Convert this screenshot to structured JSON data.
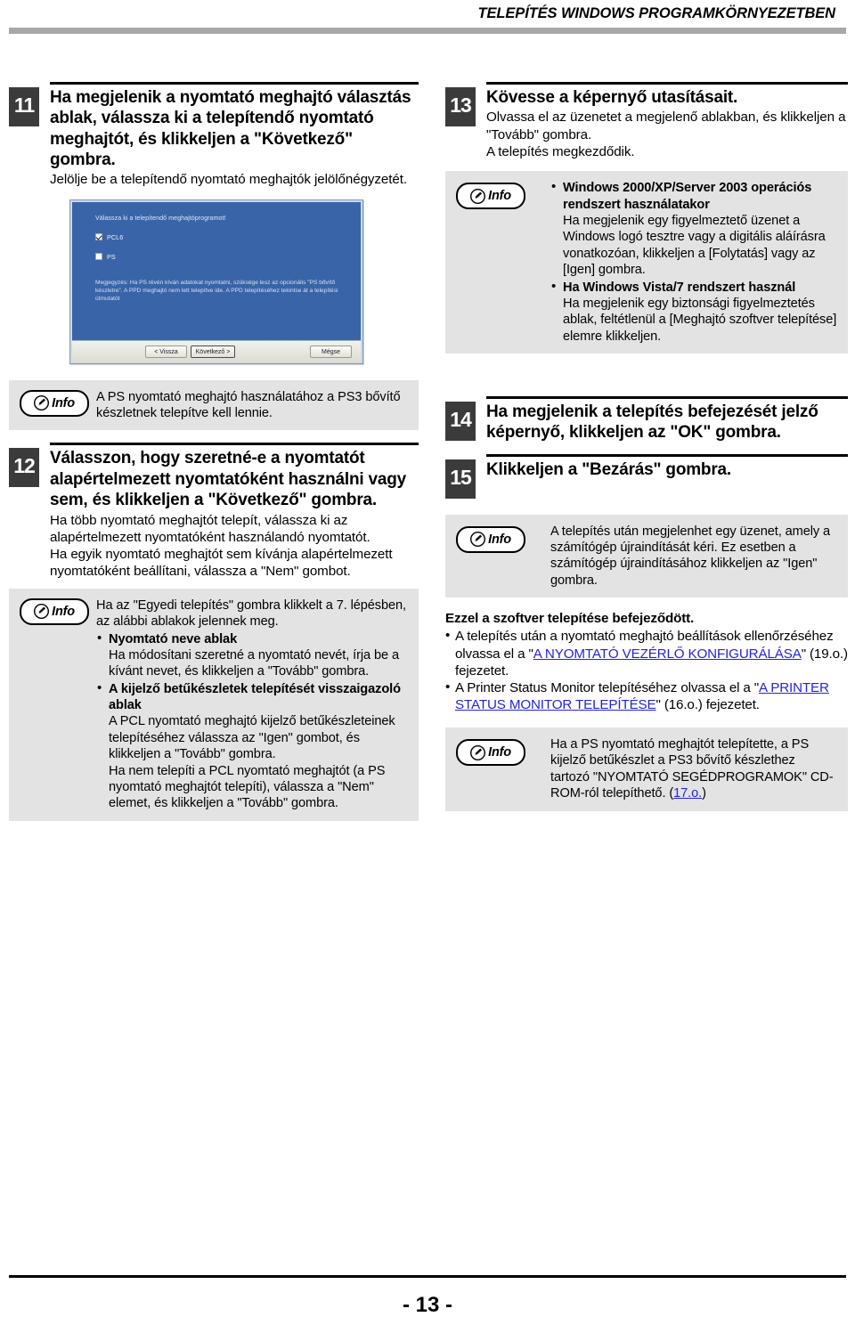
{
  "header": {
    "title": "TELEPÍTÉS WINDOWS PROGRAMKÖRNYEZETBEN"
  },
  "footer": {
    "page_number": "- 13 -"
  },
  "info_label": "Info",
  "left_column": {
    "step11": {
      "number": "11",
      "title": "Ha megjelenik a nyomtató meghajtó választás ablak, válassza ki a telepítendő nyomtató meghajtót, és klikkeljen a \"Következő\" gombra.",
      "text": "Jelölje be a telepítendő nyomtató meghajtók jelölőnégyzetét."
    },
    "screenshot": {
      "prompt": "Válassza ki a telepítendő meghajtóprogramot!",
      "options": [
        {
          "label": "PCL6",
          "checked": true
        },
        {
          "label": "PS",
          "checked": false
        }
      ],
      "note": "Megjegyzés: Ha PS révén kíván adatokat nyomtatni, szüksége lesz az opcionális \"PS bővítő készletre\". A PPD meghajtó nem lett telepítve ide. A PPD telepítéséhez tekintse át a telepítési útmutatót",
      "buttons": {
        "back": "< Vissza",
        "next": "Következő >",
        "cancel": "Mégse"
      }
    },
    "info_ps": "A PS nyomtató meghajtó használatához a PS3 bővítő készletnek telepítve kell lennie.",
    "step12": {
      "number": "12",
      "title": "Válasszon, hogy szeretné-e a nyomtatót alapértelmezett nyomtatóként használni vagy sem, és klikkeljen a \"Következő\" gombra.",
      "text1": "Ha több nyomtató meghajtót telepít, válassza ki az alapértelmezett nyomtatóként használandó nyomtatót.",
      "text2": "Ha egyik nyomtató meghajtót sem kívánja alapértelmezett nyomtatóként beállítani, válassza a \"Nem\" gombot."
    },
    "info_custom": {
      "intro": "Ha az \"Egyedi telepítés\" gombra klikkelt a 7. lépésben, az alábbi ablakok jelennek meg.",
      "bullets": [
        {
          "head": "Nyomtató neve ablak",
          "body": "Ha módosítani szeretné a nyomtató nevét, írja be a kívánt nevet, és klikkeljen a \"Tovább\" gombra."
        },
        {
          "head": "A kijelző betűkészletek telepítését visszaigazoló ablak",
          "body": "A PCL nyomtató meghajtó kijelző betűkészleteinek telepítéséhez válassza az \"Igen\" gombot, és klikkeljen a \"Tovább\" gombra.",
          "body2": "Ha nem telepíti a PCL nyomtató meghajtót (a PS nyomtató meghajtót telepíti), válassza a \"Nem\" elemet, és klikkeljen a \"Tovább\" gombra."
        }
      ]
    }
  },
  "right_column": {
    "step13": {
      "number": "13",
      "title": "Kövesse a képernyő utasításait.",
      "text1": "Olvassa el az üzenetet a megjelenő ablakban, és klikkeljen a \"Tovább\" gombra.",
      "text2": "A telepítés megkezdődik."
    },
    "info_os": {
      "bullets": [
        {
          "head": "Windows 2000/XP/Server 2003 operációs rendszert használatakor",
          "body": "Ha megjelenik egy figyelmeztető üzenet a Windows logó tesztre vagy a digitális aláírásra vonatkozóan, klikkeljen a [Folytatás] vagy az [Igen] gombra."
        },
        {
          "head": "Ha Windows Vista/7 rendszert használ",
          "body": "Ha megjelenik egy biztonsági figyelmeztetés ablak, feltétlenül a [Meghajtó szoftver telepítése] elemre klikkeljen."
        }
      ]
    },
    "step14": {
      "number": "14",
      "title": "Ha megjelenik a telepítés befejezését jelző képernyő, klikkeljen az \"OK\" gombra."
    },
    "step15": {
      "number": "15",
      "title": "Klikkeljen a \"Bezárás\" gombra."
    },
    "info_restart": "A telepítés után megjelenhet egy üzenet, amely a számítógép újraindítását kéri. Ez esetben a számítógép újraindításához klikkeljen az \"Igen\" gombra.",
    "closing": {
      "heading": "Ezzel a szoftver telepítése befejeződött.",
      "item1_pre": "A telepítés után a nyomtató meghajtó beállítások ellenőrzéséhez olvassa el a \"",
      "item1_link": "A NYOMTATÓ VEZÉRLŐ KONFIGURÁLÁSA",
      "item1_post": "\" (19.o.) fejezetet.",
      "item2_pre": "A Printer Status Monitor telepítéséhez olvassa el a \"",
      "item2_link": "A PRINTER STATUS MONITOR TELEPÍTÉSE",
      "item2_post": "\" (16.o.) fejezetet."
    },
    "info_psfont": {
      "text_pre": "Ha a PS nyomtató meghajtót telepítette, a PS kijelző betűkészlet a PS3 bővítő készlethez tartozó \"NYOMTATÓ SEGÉDPROGRAMOK\" CD-ROM-ról telepíthető. (",
      "link": "17.o.",
      "text_post": ")"
    }
  },
  "colors": {
    "link": "#2424d8",
    "dialog_blue": "#3a64a8",
    "info_background": "#e3e3e3",
    "step_number_background": "#3b3b3b",
    "header_rule": "#a8a8a8"
  }
}
